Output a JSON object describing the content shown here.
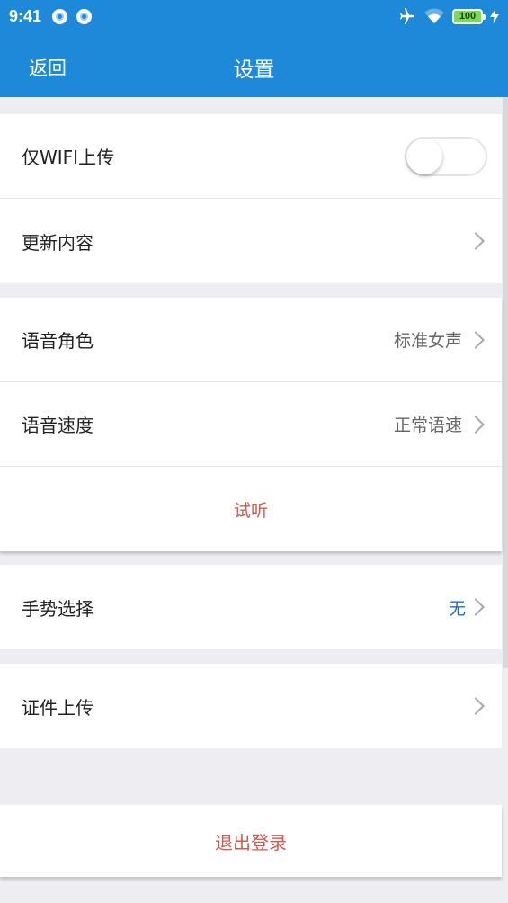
{
  "status_bar": {
    "time": "9:41",
    "battery": "100",
    "icons": [
      "app-notification-icon",
      "app-notification-icon",
      "airplane-icon",
      "wifi-icon",
      "battery-icon",
      "charging-icon"
    ]
  },
  "nav": {
    "back_label": "返回",
    "title": "设置"
  },
  "group1": {
    "wifi_upload_label": "仅WIFI上传",
    "wifi_upload_enabled": false,
    "update_content_label": "更新内容"
  },
  "group2": {
    "voice_role_label": "语音角色",
    "voice_role_value": "标准女声",
    "voice_speed_label": "语音速度",
    "voice_speed_value": "正常语速",
    "preview_label": "试听"
  },
  "group3": {
    "gesture_label": "手势选择",
    "gesture_value": "无"
  },
  "group4": {
    "certificate_label": "证件上传"
  },
  "logout_label": "退出登录",
  "colors": {
    "primary": "#1e88d9",
    "accent_red": "#d45a4f",
    "value_blue": "#1e6fb5",
    "background": "#eeeef2"
  }
}
